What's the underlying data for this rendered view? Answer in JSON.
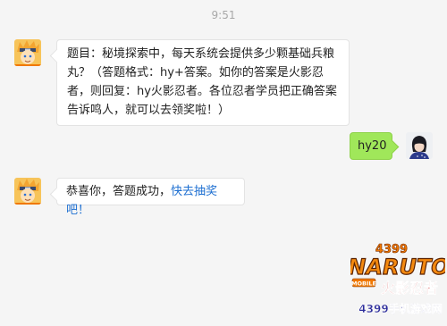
{
  "timestamp": "9:51",
  "messages": {
    "question": {
      "text": "题目：秘境探索中，每天系统会提供多少颗基础兵粮丸？（答题格式：hy+答案。如你的答案是火影忍者，则回复：hy火影忍者。各位忍者学员把正确答案告诉鸣人，就可以去领奖啦！）"
    },
    "reply": {
      "text": "hy20"
    },
    "result": {
      "text": "恭喜你，答题成功，",
      "link": "快去抽奖吧！"
    }
  },
  "watermark": {
    "number": "4399",
    "brand": "NARUTO",
    "title_cn": "火影忍者",
    "tag": "MOBILE",
    "site": "4399手机游戏网"
  },
  "colors": {
    "background": "#f5f5f5",
    "bubble_in": "#ffffff",
    "bubble_out": "#a0e75a",
    "link": "#1d6fd1",
    "brand_orange": "#f07800"
  },
  "icons": {
    "bot_avatar": "naruto-avatar-icon",
    "user_avatar": "user-avatar-icon"
  }
}
